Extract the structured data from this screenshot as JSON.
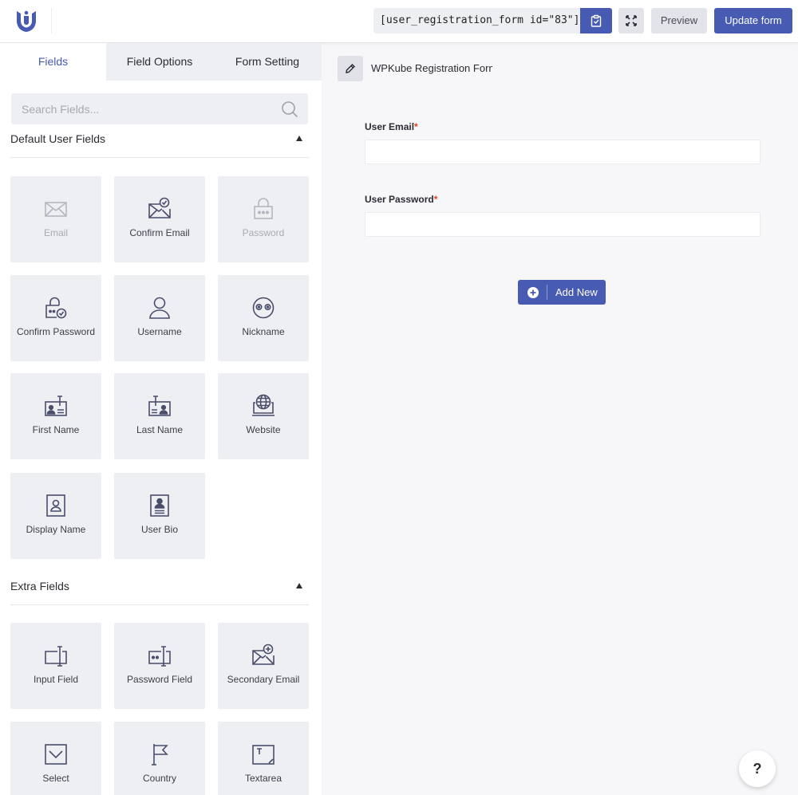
{
  "header": {
    "shortcode": "[user_registration_form id=\"83\"]",
    "preview_label": "Preview",
    "update_label": "Update form",
    "accent_color": "#475bb2"
  },
  "tabs": [
    {
      "label": "Fields",
      "active": true
    },
    {
      "label": "Field Options",
      "active": false
    },
    {
      "label": "Form Setting",
      "active": false
    }
  ],
  "search": {
    "placeholder": "Search Fields..."
  },
  "sections": [
    {
      "title": "Default User Fields",
      "expanded": true
    },
    {
      "title": "Extra Fields",
      "expanded": true
    }
  ],
  "default_fields": [
    {
      "label": "Email",
      "icon": "envelope-icon",
      "disabled": true
    },
    {
      "label": "Confirm Email",
      "icon": "envelope-check-icon",
      "disabled": false
    },
    {
      "label": "Password",
      "icon": "lock-icon",
      "disabled": true
    },
    {
      "label": "Confirm Password",
      "icon": "lock-check-icon",
      "disabled": false
    },
    {
      "label": "Username",
      "icon": "user-icon",
      "disabled": false
    },
    {
      "label": "Nickname",
      "icon": "mask-icon",
      "disabled": false
    },
    {
      "label": "First Name",
      "icon": "id-card-icon",
      "disabled": false
    },
    {
      "label": "Last Name",
      "icon": "id-card-icon",
      "disabled": false
    },
    {
      "label": "Website",
      "icon": "globe-monitor-icon",
      "disabled": false
    },
    {
      "label": "Display Name",
      "icon": "portrait-icon",
      "disabled": false
    },
    {
      "label": "User Bio",
      "icon": "bio-icon",
      "disabled": false
    }
  ],
  "extra_fields": [
    {
      "label": "Input Field",
      "icon": "text-input-icon",
      "disabled": false
    },
    {
      "label": "Password Field",
      "icon": "password-input-icon",
      "disabled": false
    },
    {
      "label": "Secondary Email",
      "icon": "envelope-plus-icon",
      "disabled": false
    },
    {
      "label": "Select",
      "icon": "select-icon",
      "disabled": false
    },
    {
      "label": "Country",
      "icon": "flag-icon",
      "disabled": false
    },
    {
      "label": "Textarea",
      "icon": "textarea-icon",
      "disabled": false
    }
  ],
  "canvas": {
    "form_title": "WPKube Registration Form",
    "fields": [
      {
        "label": "User Email",
        "required_mark": "*",
        "value": ""
      },
      {
        "label": "User Password",
        "required_mark": "*",
        "value": ""
      }
    ],
    "add_new_label": "Add New"
  },
  "help_label": "?"
}
